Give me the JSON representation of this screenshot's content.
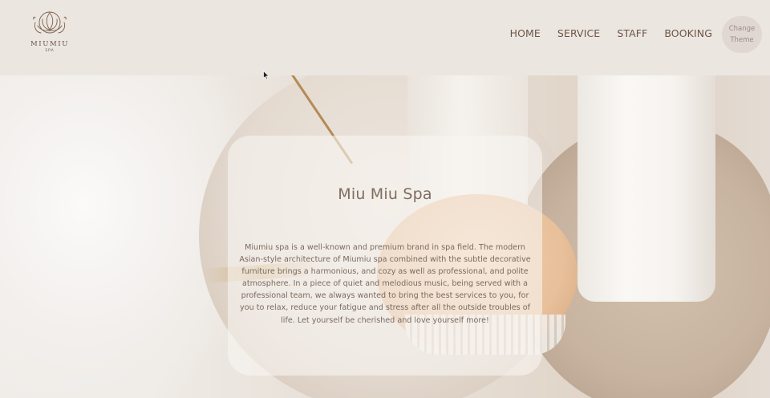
{
  "brand": {
    "name": "MIUMIU",
    "sub": "SPA",
    "logo_icon": "lotus-logo-icon"
  },
  "nav": {
    "items": [
      {
        "label": "HOME"
      },
      {
        "label": "SERVICE"
      },
      {
        "label": "STAFF"
      },
      {
        "label": "BOOKING"
      }
    ],
    "theme_button": "Change Theme"
  },
  "hero": {
    "title": "Miu Miu Spa",
    "description": "Miumiu spa is a well-known and premium brand in spa field. The modern Asian-style architecture of Miumiu spa combined with the subtle decorative furniture brings a harmonious, and cozy as well as professional, and polite atmosphere. In a piece of quiet and melodious music, being served with a professional team, we always wanted to bring the best services to you, for you to relax, reduce your fatigue and stress after all the outside troubles of life. Let yourself be cherished and love yourself more!"
  },
  "colors": {
    "header_bg": "#ece6e1",
    "nav_text": "#6b5645",
    "card_text": "#7a6a5f",
    "theme_button_bg": "#e0d7d2"
  }
}
